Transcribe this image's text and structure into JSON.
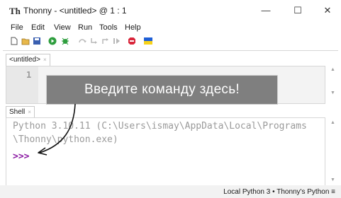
{
  "window": {
    "title": "Thonny  -  <untitled>  @  1 : 1",
    "app_icon_text": "Th",
    "minimize_glyph": "—",
    "maximize_glyph": "☐",
    "close_glyph": "✕"
  },
  "menu": [
    "File",
    "Edit",
    "View",
    "Run",
    "Tools",
    "Help"
  ],
  "toolbar_icons": [
    "new-file-icon",
    "open-file-icon",
    "save-icon",
    "run-icon",
    "debug-icon",
    "step-over-icon",
    "step-into-icon",
    "step-out-icon",
    "resume-icon",
    "stop-icon",
    "support-ukraine-icon"
  ],
  "editor": {
    "tab_label": "<untitled>",
    "tab_close": "×",
    "line_numbers": [
      "1"
    ]
  },
  "shell": {
    "tab_label": "Shell",
    "tab_close": "×",
    "output_line1": "Python 3.10.11 (C:\\Users\\ismay\\AppData\\Local\\Programs",
    "output_line2": "\\Thonny\\python.exe)",
    "prompt": ">>>"
  },
  "status": {
    "text": "Local Python 3  •  Thonny's Python  ≡"
  },
  "callout": {
    "text": "Введите команду здесь!"
  },
  "colors": {
    "prompt": "#8b1aa3",
    "callout_bg": "#7f7f7f",
    "run_green": "#2e9e3e",
    "stop_red": "#d9263b"
  }
}
